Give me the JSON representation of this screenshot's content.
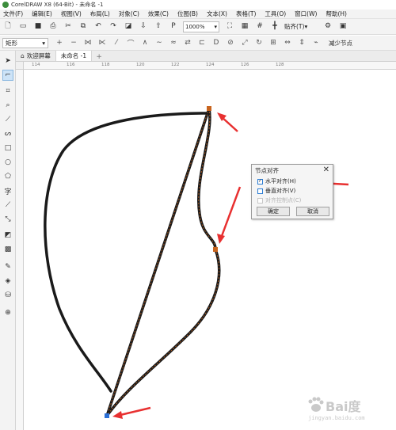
{
  "window": {
    "title": "CorelDRAW X8 (64-Bit) - 未命名 -1"
  },
  "menu": [
    "文件(F)",
    "编辑(E)",
    "视图(V)",
    "布局(L)",
    "对象(C)",
    "效果(C)",
    "位图(B)",
    "文本(X)",
    "表格(T)",
    "工具(O)",
    "窗口(W)",
    "帮助(H)"
  ],
  "toolbar": {
    "zoom_value": "1000%",
    "snap_label": "贴齐(T)"
  },
  "propbar": {
    "shape_select": "矩形",
    "reduce_nodes_label": "减少节点"
  },
  "tabs": {
    "welcome": "欢迎屏幕",
    "doc": "未命名 -1"
  },
  "ruler": {
    "h_ticks": [
      "114",
      "116",
      "118",
      "120",
      "122",
      "124",
      "126",
      "128"
    ]
  },
  "dialog": {
    "title": "节点对齐",
    "opt_horizontal": "水平对齐(H)",
    "opt_vertical": "垂直对齐(V)",
    "opt_control": "对齐控制点(C)",
    "ok": "确定",
    "cancel": "取消"
  },
  "watermark": {
    "text": "Bai度",
    "sub": "jingyan.baidu.com"
  },
  "colors": {
    "curve": "#1a1a1a",
    "node_highlight": "#c8641e",
    "arrow": "#e83030",
    "selected_node": "#2b6fd6"
  }
}
